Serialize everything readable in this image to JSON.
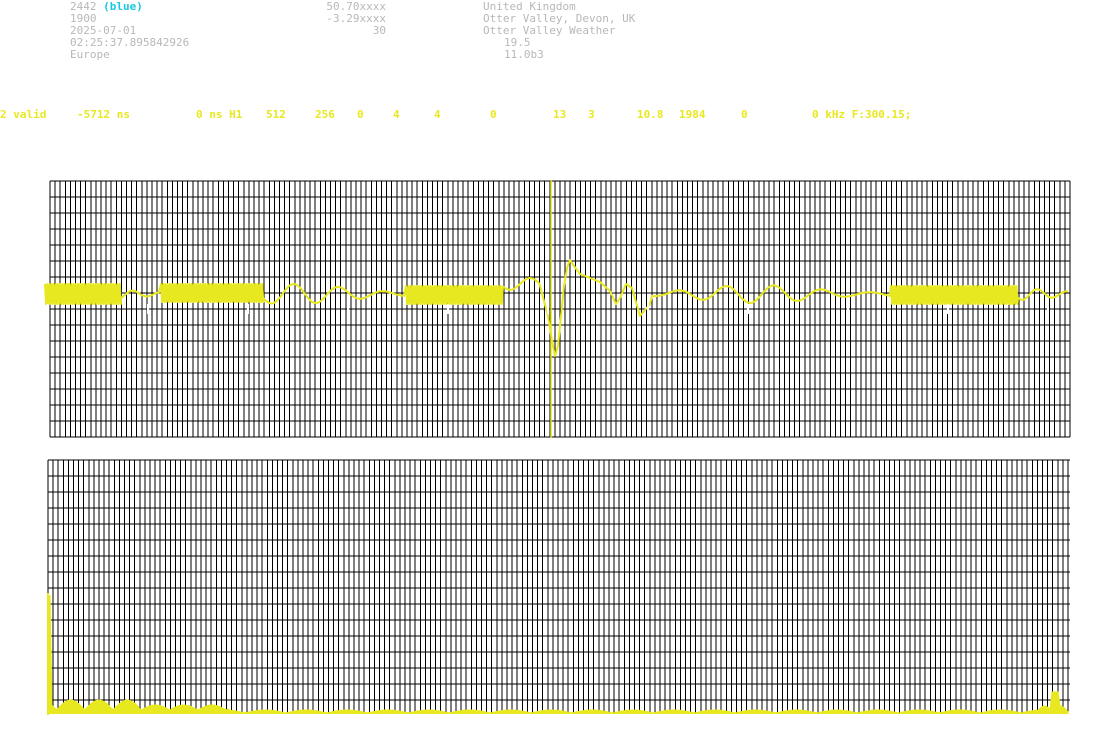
{
  "station": {
    "id": "2442",
    "color_label": "(blue)",
    "altitude": "1900",
    "date": "2025-07-01",
    "time": "02:25:37.895842926",
    "region": "Europe",
    "latitude": "50.70xxxx",
    "longitude": "-3.29xxxx",
    "value_30": "30",
    "country": "United Kingdom",
    "location": "Otter Valley, Devon, UK",
    "name": "Otter Valley Weather",
    "value_a": "19.5",
    "version": "11.0b3"
  },
  "status_line": [
    {
      "text": "2 valid"
    },
    {
      "text": "-5712 ns"
    },
    {
      "text": "0 ns H1"
    },
    {
      "text": "512"
    },
    {
      "text": "256"
    },
    {
      "text": "0"
    },
    {
      "text": "4"
    },
    {
      "text": "4"
    },
    {
      "text": "0"
    },
    {
      "text": "13"
    },
    {
      "text": "3"
    },
    {
      "text": "10.8"
    },
    {
      "text": "1984"
    },
    {
      "text": "0"
    },
    {
      "text": "0 kHz F:300.15;"
    }
  ],
  "colors": {
    "background": "#ffffff",
    "grid": "#000000",
    "signal": "#e8e820",
    "header_text": "#b8b8b8",
    "station_color": "#18c8e0"
  }
}
